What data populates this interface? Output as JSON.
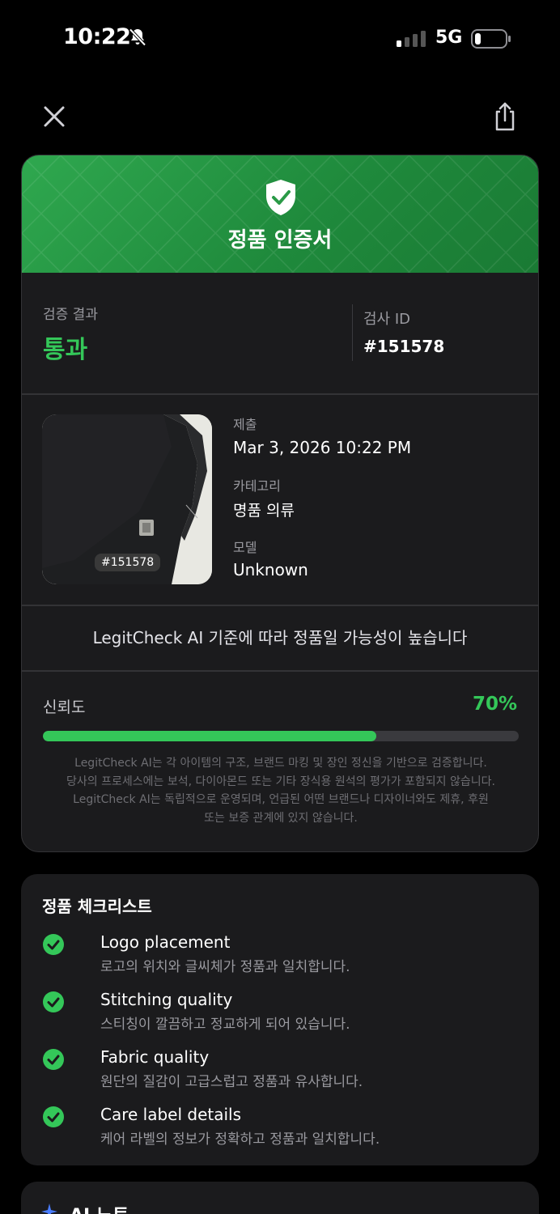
{
  "status_bar": {
    "time": "10:22",
    "network": "5G"
  },
  "certificate": {
    "title": "정품 인증서",
    "result_label": "검증 결과",
    "result_value": "통과",
    "id_label": "검사 ID",
    "id_value": "#151578",
    "thumb_tag": "#151578",
    "submitted_label": "제출",
    "submitted_value": "Mar 3, 2026 10:22 PM",
    "category_label": "카테고리",
    "category_value": "명품 의류",
    "model_label": "모델",
    "model_value": "Unknown",
    "statement": "LegitCheck AI 기준에 따라 정품일 가능성이 높습니다",
    "confidence_label": "신뢰도",
    "confidence_value": "70%",
    "confidence_fraction": 0.7,
    "disclaimer_lines": [
      "LegitCheck AI는 각 아이템의 구조, 브랜드 마킹 및 장인 정신을 기반으로 검증합니다.",
      "당사의 프로세스에는 보석, 다이아몬드 또는 기타 장식용 원석의 평가가 포함되지 않습니다.",
      "LegitCheck AI는 독립적으로 운영되며, 언급된 어떤 브랜드나 디자이너와도 제휴, 후원",
      "또는 보증 관계에 있지 않습니다."
    ]
  },
  "checklist": {
    "title": "정품 체크리스트",
    "items": [
      {
        "name": "Logo placement",
        "desc": "로고의 위치와 글씨체가 정품과 일치합니다."
      },
      {
        "name": "Stitching quality",
        "desc": "스티칭이 깔끔하고 정교하게 되어 있습니다."
      },
      {
        "name": "Fabric quality",
        "desc": "원단의 질감이 고급스럽고 정품과 유사합니다."
      },
      {
        "name": "Care label details",
        "desc": "케어 라벨의 정보가 정확하고 정품과 일치합니다."
      }
    ]
  },
  "notes": {
    "title": "AI 노트"
  },
  "colors": {
    "accent": "#34c759",
    "header_green": "#2fa84f",
    "card_bg": "#1b1b1d"
  }
}
